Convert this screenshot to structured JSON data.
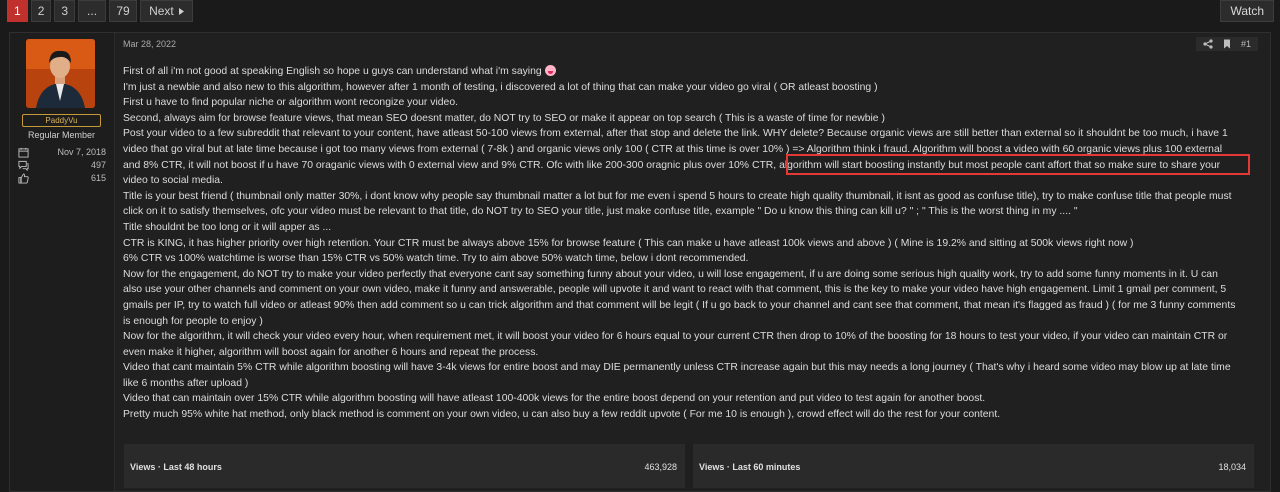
{
  "pagination": {
    "pages": [
      "1",
      "2",
      "3",
      "...",
      "79"
    ],
    "next_label": "Next"
  },
  "watch_label": "Watch",
  "user": {
    "name": "PaddyVu",
    "role": "Regular Member",
    "joined": "Nov 7, 2018",
    "messages": "497",
    "reactions": "615"
  },
  "post": {
    "date": "Mar 28, 2022",
    "number": "#1",
    "paragraphs": [
      "First of all i'm not good at speaking English so hope u guys can understand what i'm saying",
      "I'm just a newbie and also new to this algorithm, however after 1 month of testing, i discovered a lot of thing that can make your video go viral ( OR atleast boosting )",
      "First u have to find popular niche or algorithm wont recongize your video.",
      "Second, always aim for browse feature views, that mean SEO doesnt matter, do NOT try to SEO or make it appear on top search ( This is a waste of time for newbie )",
      "Post your video to a few subreddit that relevant to your content, have atleast 50-100 views from external, after that stop and delete the link. WHY delete? Because organic views are still better than external so it shouldnt be too much, i have 1 video that go viral but at late time because i got too many views from external ( 7-8k ) and organic views only 100 ( CTR at this time is over 10% ) => Algorithm think i fraud. Algorithm will boost a video with 60 organic views plus 100 external and 8% CTR, it will not boost if u have 70 oraganic views with 0 external view and 9% CTR. Ofc with like 200-300 oragnic plus over 10% CTR, algorithm will start boosting instantly but most people cant affort that so make sure to share your video to social media.",
      "Title is your best friend ( thumbnail only matter 30%, i dont know why people say thumbnail matter a lot but for me even i spend 5 hours to create high quality thumbnail, it isnt as good as confuse title), try to make confuse title that people must click on it to satisfy themselves, ofc your video must be relevant to that title, do NOT try to SEO your title, just make confuse title, example \" Do u know this thing can kill u? \" ; \" This is the worst thing in my .... \"",
      "Title shouldnt be too long or it will apper as ...",
      "CTR is KING, it has higher priority over high retention. Your CTR must be always above 15% for browse feature ( This can make u have atleast 100k views and above ) ( Mine is 19.2% and sitting at 500k views right now )",
      "6% CTR vs 100% watchtime is worse than 15% CTR vs 50% watch time. Try to aim above 50% watch time, below i dont recommended.",
      "Now for the engagement, do NOT try to make your video perfectly that everyone cant say something funny about your video, u will lose engagement, if u are doing some serious high quality work, try to add some funny moments in it. U can also use your other channels and comment on your own video, make it funny and answerable, people will upvote it and want to react with that comment, this is the key to make your video have high engagement. Limit 1 gmail per comment, 5 gmails per IP, try to watch full video or atleast 90% then add comment so u can trick algorithm and that comment will be legit ( If u go back to your channel and cant see that comment, that mean it's flagged as fraud ) ( for me 3 funny comments is enough for people to enjoy )",
      "Now for the algorithm, it will check your video every hour, when requirement met, it will boost your video for 6 hours equal to your current CTR then drop to 10% of the boosting for 18 hours to test your video, if your video can maintain CTR or even make it higher, algorithm will boost again for another 6 hours and repeat the process.",
      "Video that cant maintain 5% CTR while algorithm boosting will have 3-4k views for entire boost and may DIE permanently unless CTR increase again but this may needs a long journey ( That's why i heard some video may blow up at late time like 6 months after upload )",
      "Video that can maintain over 15% CTR while algorithm boosting will have atleast 100-400k views for the entire boost depend on your retention and put video to test again for another boost.",
      "Pretty much 95% white hat method, only black method is comment on your own video, u can also buy a few reddit upvote ( For me 10 is enough ), crowd effect will do the rest for your content."
    ]
  },
  "views": {
    "label_48h": "Views · Last 48 hours",
    "value_48h": "463,928",
    "label_60m": "Views · Last 60 minutes",
    "value_60m": "18,034"
  },
  "colors": {
    "accent": "#c0302c",
    "username": "#d9b25a",
    "highlight_box": "#e53935"
  },
  "icons": [
    "chevron-right-icon",
    "calendar-icon",
    "messages-icon",
    "thumbs-up-icon",
    "share-icon",
    "bookmark-icon"
  ]
}
